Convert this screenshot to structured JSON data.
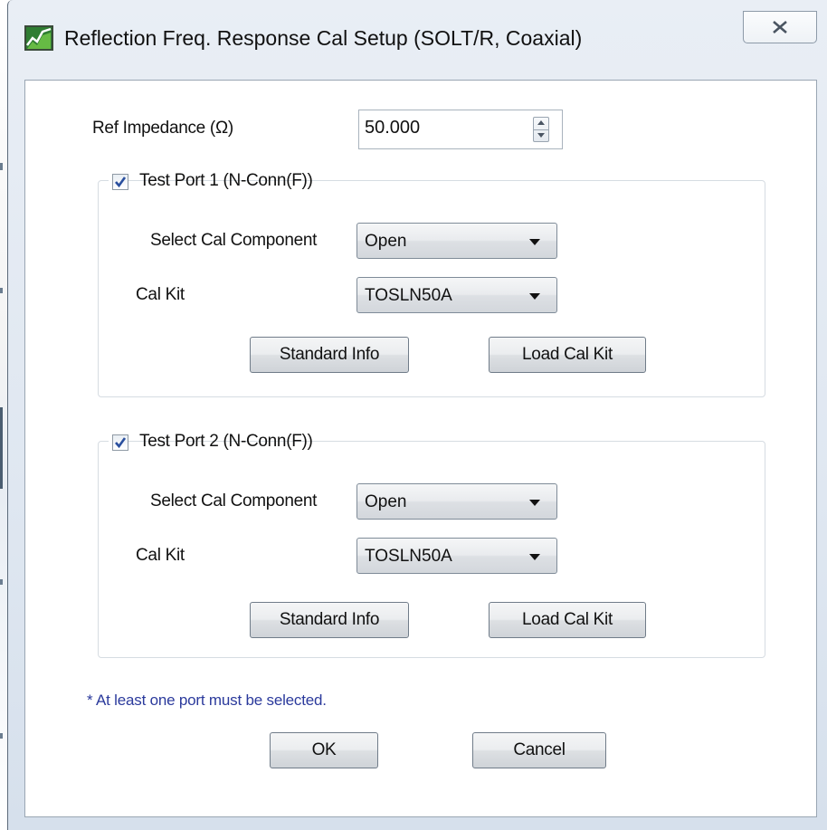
{
  "window": {
    "title": "Reflection Freq. Response Cal Setup (SOLT/R, Coaxial)",
    "icon": "app-icon",
    "close_icon": "close-icon"
  },
  "ref_impedance": {
    "label": "Ref Impedance (Ω)",
    "value": "50.000"
  },
  "ports": [
    {
      "checked": true,
      "label": "Test Port 1 (N-Conn(F))",
      "component_label": "Select Cal Component",
      "component_value": "Open",
      "kit_label": "Cal Kit",
      "kit_value": "TOSLN50A",
      "standard_info_label": "Standard Info",
      "load_cal_kit_label": "Load Cal Kit"
    },
    {
      "checked": true,
      "label": "Test Port 2 (N-Conn(F))",
      "component_label": "Select Cal Component",
      "component_value": "Open",
      "kit_label": "Cal Kit",
      "kit_value": "TOSLN50A",
      "standard_info_label": "Standard Info",
      "load_cal_kit_label": "Load Cal Kit"
    }
  ],
  "note": "* At least one port must be selected.",
  "buttons": {
    "ok": "OK",
    "cancel": "Cancel"
  },
  "colors": {
    "note": "#2b3a9c",
    "check": "#2a4f9e"
  }
}
